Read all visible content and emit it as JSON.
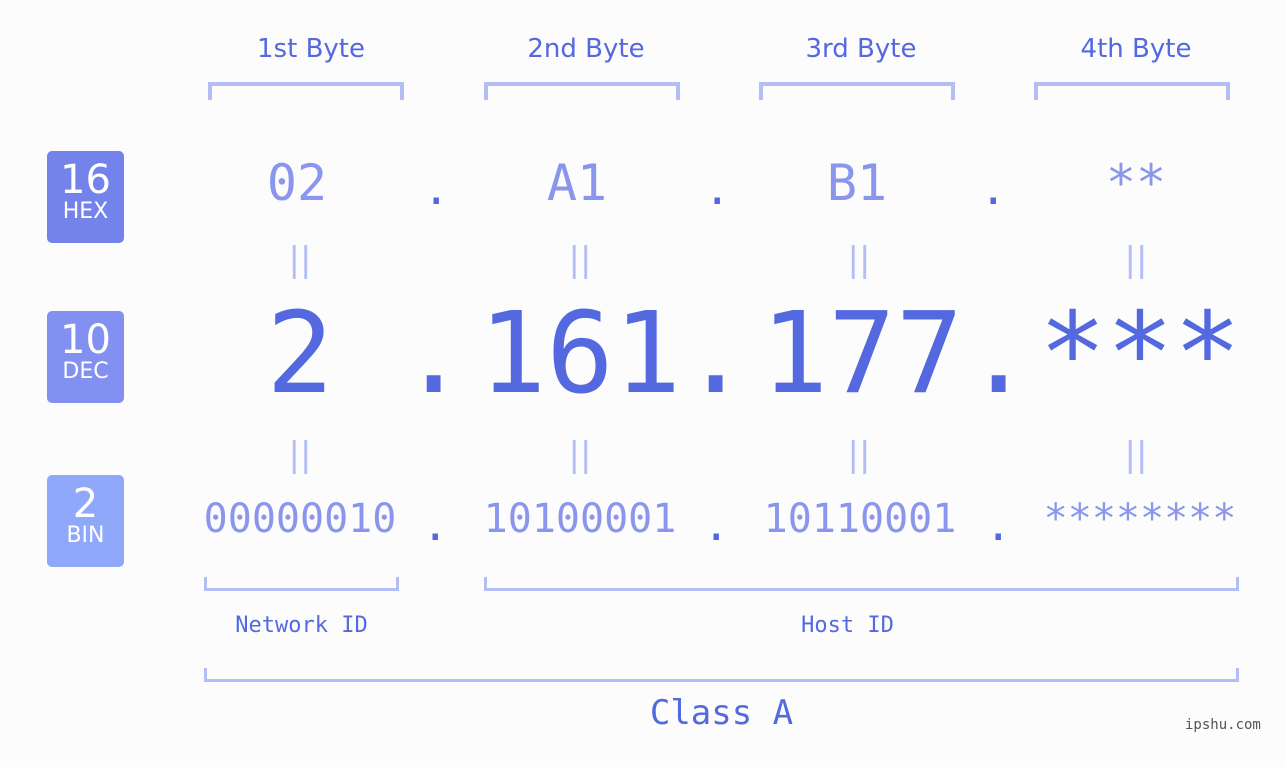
{
  "bytes": {
    "headers": [
      "1st Byte",
      "2nd Byte",
      "3rd Byte",
      "4th Byte"
    ]
  },
  "rows": {
    "hex": {
      "badge_num": "16",
      "badge_label": "HEX",
      "color": "#7383eb",
      "values": [
        "02",
        "A1",
        "B1",
        "**"
      ]
    },
    "dec": {
      "badge_num": "10",
      "badge_label": "DEC",
      "color": "#8190f1",
      "values": [
        "2",
        "161",
        "177",
        "***"
      ]
    },
    "bin": {
      "badge_num": "2",
      "badge_label": "BIN",
      "color": "#8fa8fa",
      "values": [
        "00000010",
        "10100001",
        "10110001",
        "********"
      ]
    }
  },
  "separator": ".",
  "equals": "||",
  "network_id_label": "Network ID",
  "host_id_label": "Host ID",
  "class_label": "Class A",
  "watermark": "ipshu.com",
  "colors": {
    "accent": "#5468e0",
    "light": "#8a95ee",
    "bracket": "#b3bdf6",
    "background": "#fbfcfb"
  }
}
